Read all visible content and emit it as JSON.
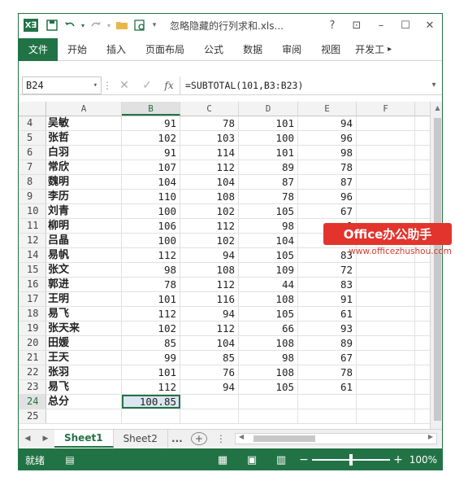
{
  "window": {
    "title": "忽略隐藏的行列求和.xls...",
    "help": "?",
    "controls": [
      "⊡",
      "–",
      "☐",
      "✕"
    ]
  },
  "quick_access": {
    "logo_text": "X∃",
    "save_icon": "save-icon",
    "undo_icon": "undo-icon",
    "redo_icon": "redo-icon",
    "open_icon": "folder-icon",
    "preview_icon": "preview-icon",
    "more_icon": "dropdown-icon"
  },
  "ribbon": {
    "tabs": [
      "文件",
      "开始",
      "插入",
      "页面布局",
      "公式",
      "数据",
      "审阅",
      "视图",
      "开发工"
    ],
    "more": "▸"
  },
  "formula_bar": {
    "name_box": "B24",
    "fx": "fx",
    "formula": "=SUBTOTAL(101,B3:B23)"
  },
  "columns": [
    "A",
    "B",
    "C",
    "D",
    "E",
    "F"
  ],
  "rows": [
    {
      "n": "4",
      "a": "吴敏",
      "b": "91",
      "c": "78",
      "d": "101",
      "e": "94"
    },
    {
      "n": "5",
      "a": "张哲",
      "b": "102",
      "c": "103",
      "d": "100",
      "e": "96"
    },
    {
      "n": "6",
      "a": "白羽",
      "b": "91",
      "c": "114",
      "d": "101",
      "e": "98"
    },
    {
      "n": "7",
      "a": "常欣",
      "b": "107",
      "c": "112",
      "d": "89",
      "e": "78"
    },
    {
      "n": "8",
      "a": "魏明",
      "b": "104",
      "c": "104",
      "d": "87",
      "e": "87"
    },
    {
      "n": "9",
      "a": "李历",
      "b": "110",
      "c": "108",
      "d": "78",
      "e": "96"
    },
    {
      "n": "10",
      "a": "刘青",
      "b": "100",
      "c": "102",
      "d": "105",
      "e": "67"
    },
    {
      "n": "11",
      "a": "柳明",
      "b": "106",
      "c": "112",
      "d": "98",
      "e": "9"
    },
    {
      "n": "12",
      "a": "吕晶",
      "b": "100",
      "c": "102",
      "d": "104",
      "e": "86"
    },
    {
      "n": "14",
      "a": "易帆",
      "b": "112",
      "c": "94",
      "d": "105",
      "e": "83"
    },
    {
      "n": "15",
      "a": "张文",
      "b": "98",
      "c": "108",
      "d": "109",
      "e": "72"
    },
    {
      "n": "16",
      "a": "郭进",
      "b": "78",
      "c": "112",
      "d": "44",
      "e": "83"
    },
    {
      "n": "17",
      "a": "王明",
      "b": "101",
      "c": "116",
      "d": "108",
      "e": "91"
    },
    {
      "n": "18",
      "a": "易飞",
      "b": "112",
      "c": "94",
      "d": "105",
      "e": "61"
    },
    {
      "n": "19",
      "a": "张天来",
      "b": "102",
      "c": "112",
      "d": "66",
      "e": "93"
    },
    {
      "n": "20",
      "a": "田媛",
      "b": "85",
      "c": "104",
      "d": "108",
      "e": "89"
    },
    {
      "n": "21",
      "a": "王天",
      "b": "99",
      "c": "85",
      "d": "98",
      "e": "67"
    },
    {
      "n": "22",
      "a": "张羽",
      "b": "101",
      "c": "76",
      "d": "108",
      "e": "78"
    },
    {
      "n": "23",
      "a": "易飞",
      "b": "112",
      "c": "94",
      "d": "105",
      "e": "61"
    },
    {
      "n": "24",
      "a": "总分",
      "b": "100.85",
      "c": "",
      "d": "",
      "e": ""
    },
    {
      "n": "25",
      "a": "",
      "b": "",
      "c": "",
      "d": "",
      "e": ""
    }
  ],
  "sheets": {
    "tabs": [
      "Sheet1",
      "Sheet2"
    ],
    "active": "Sheet1",
    "more": "...",
    "add": "+"
  },
  "status": {
    "ready": "就绪",
    "zoom": "100%",
    "zoom_minus": "−",
    "zoom_plus": "+"
  },
  "watermark": {
    "badge": "Office办公助手",
    "url": "www.officezhushou.com"
  }
}
